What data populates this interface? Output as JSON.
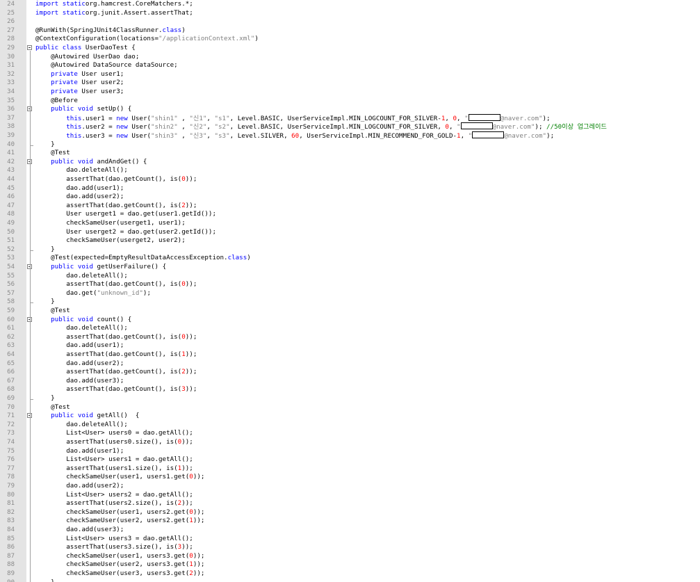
{
  "editor": {
    "lines": [
      {
        "n": "24",
        "fold": "",
        "tokens": [
          [
            "kw",
            "import static"
          ],
          [
            "",
            "org.hamcrest.CoreMatchers.*;"
          ]
        ]
      },
      {
        "n": "25",
        "fold": "",
        "tokens": [
          [
            "kw",
            "import static"
          ],
          [
            "",
            "org.junit.Assert.assertThat;"
          ]
        ]
      },
      {
        "n": "26",
        "fold": "",
        "tokens": []
      },
      {
        "n": "27",
        "fold": "",
        "tokens": [
          [
            "",
            "@RunWith(SpringJUnit4ClassRunner."
          ],
          [
            "kw",
            "class"
          ],
          [
            "",
            ")"
          ]
        ]
      },
      {
        "n": "28",
        "fold": "",
        "tokens": [
          [
            "",
            "@ContextConfiguration(locations="
          ],
          [
            "str",
            "\"/applicationContext.xml\""
          ],
          [
            "",
            ")"
          ]
        ]
      },
      {
        "n": "29",
        "fold": "open",
        "tokens": [
          [
            "kw",
            "public class"
          ],
          [
            "",
            " UserDaoTest {"
          ]
        ]
      },
      {
        "n": "30",
        "fold": "",
        "tokens": [
          [
            "",
            "    @Autowired UserDao dao;"
          ]
        ]
      },
      {
        "n": "31",
        "fold": "",
        "tokens": [
          [
            "",
            "    @Autowired DataSource dataSource;"
          ]
        ]
      },
      {
        "n": "32",
        "fold": "",
        "tokens": [
          [
            "",
            "    "
          ],
          [
            "kw",
            "private"
          ],
          [
            "",
            " User user1;"
          ]
        ]
      },
      {
        "n": "33",
        "fold": "",
        "tokens": [
          [
            "",
            "    "
          ],
          [
            "kw",
            "private"
          ],
          [
            "",
            " User user2;"
          ]
        ]
      },
      {
        "n": "34",
        "fold": "",
        "tokens": [
          [
            "",
            "    "
          ],
          [
            "kw",
            "private"
          ],
          [
            "",
            " User user3;"
          ]
        ]
      },
      {
        "n": "35",
        "fold": "",
        "tokens": [
          [
            "",
            "    @Before"
          ]
        ]
      },
      {
        "n": "36",
        "fold": "open",
        "tokens": [
          [
            "",
            "    "
          ],
          [
            "kw",
            "public void"
          ],
          [
            "",
            " setUp() {"
          ]
        ]
      },
      {
        "n": "37",
        "fold": "",
        "tokens": [
          [
            "",
            "        "
          ],
          [
            "kw",
            "this"
          ],
          [
            "",
            ".user1 = "
          ],
          [
            "kw",
            "new"
          ],
          [
            "",
            " User("
          ],
          [
            "str",
            "\"shin1\""
          ],
          [
            "",
            " , "
          ],
          [
            "str",
            "\"신1\""
          ],
          [
            "",
            ", "
          ],
          [
            "str",
            "\"s1\""
          ],
          [
            "",
            ", Level.BASIC, UserServiceImpl.MIN_LOGCOUNT_FOR_SILVER-"
          ],
          [
            "num",
            "1"
          ],
          [
            "",
            ", "
          ],
          [
            "num",
            "0"
          ],
          [
            "",
            ", "
          ],
          [
            "str",
            "\""
          ],
          [
            "redact",
            "46"
          ],
          [
            "str",
            "@naver.com\""
          ],
          [
            "",
            "); "
          ]
        ]
      },
      {
        "n": "38",
        "fold": "",
        "tokens": [
          [
            "",
            "        "
          ],
          [
            "kw",
            "this"
          ],
          [
            "",
            ".user2 = "
          ],
          [
            "kw",
            "new"
          ],
          [
            "",
            " User("
          ],
          [
            "str",
            "\"shin2\""
          ],
          [
            "",
            " , "
          ],
          [
            "str",
            "\"신2\""
          ],
          [
            "",
            ", "
          ],
          [
            "str",
            "\"s2\""
          ],
          [
            "",
            ", Level.BASIC, UserServiceImpl.MIN_LOGCOUNT_FOR_SILVER, "
          ],
          [
            "num",
            "0"
          ],
          [
            "",
            ", "
          ],
          [
            "str",
            "\""
          ],
          [
            "redact",
            "46"
          ],
          [
            "str",
            "@naver.com\""
          ],
          [
            "",
            "); "
          ],
          [
            "cmt",
            "//50이상 업그레이드"
          ]
        ]
      },
      {
        "n": "39",
        "fold": "",
        "tokens": [
          [
            "",
            "        "
          ],
          [
            "kw",
            "this"
          ],
          [
            "",
            ".user3 = "
          ],
          [
            "kw",
            "new"
          ],
          [
            "",
            " User("
          ],
          [
            "str",
            "\"shin3\""
          ],
          [
            "",
            " , "
          ],
          [
            "str",
            "\"신3\""
          ],
          [
            "",
            ", "
          ],
          [
            "str",
            "\"s3\""
          ],
          [
            "",
            ", Level.SILVER, "
          ],
          [
            "num",
            "60"
          ],
          [
            "",
            ", UserServiceImpl.MIN_RECOMMEND_FOR_GOLD-"
          ],
          [
            "num",
            "1"
          ],
          [
            "",
            ", "
          ],
          [
            "str",
            "\""
          ],
          [
            "redact",
            "46"
          ],
          [
            "str",
            "@naver.com\""
          ],
          [
            "",
            "); "
          ]
        ]
      },
      {
        "n": "40",
        "fold": "end",
        "tokens": [
          [
            "",
            "    }"
          ]
        ]
      },
      {
        "n": "41",
        "fold": "",
        "tokens": [
          [
            "",
            "    @Test"
          ]
        ]
      },
      {
        "n": "42",
        "fold": "open",
        "tokens": [
          [
            "",
            "    "
          ],
          [
            "kw",
            "public void"
          ],
          [
            "",
            " andAndGet() {"
          ]
        ]
      },
      {
        "n": "43",
        "fold": "",
        "tokens": [
          [
            "",
            "        dao.deleteAll();"
          ]
        ]
      },
      {
        "n": "44",
        "fold": "",
        "tokens": [
          [
            "",
            "        assertThat(dao.getCount(), is("
          ],
          [
            "num",
            "0"
          ],
          [
            "",
            "));"
          ]
        ]
      },
      {
        "n": "45",
        "fold": "",
        "tokens": [
          [
            "",
            "        dao.add(user1);"
          ]
        ]
      },
      {
        "n": "46",
        "fold": "",
        "tokens": [
          [
            "",
            "        dao.add(user2);"
          ]
        ]
      },
      {
        "n": "47",
        "fold": "",
        "tokens": [
          [
            "",
            "        assertThat(dao.getCount(), is("
          ],
          [
            "num",
            "2"
          ],
          [
            "",
            "));"
          ]
        ]
      },
      {
        "n": "48",
        "fold": "",
        "tokens": [
          [
            "",
            "        User userget1 = dao.get(user1.getId());"
          ]
        ]
      },
      {
        "n": "49",
        "fold": "",
        "tokens": [
          [
            "",
            "        checkSameUser(userget1, user1);"
          ]
        ]
      },
      {
        "n": "50",
        "fold": "",
        "tokens": [
          [
            "",
            "        User userget2 = dao.get(user2.getId());"
          ]
        ]
      },
      {
        "n": "51",
        "fold": "",
        "tokens": [
          [
            "",
            "        checkSameUser(userget2, user2);"
          ]
        ]
      },
      {
        "n": "52",
        "fold": "end",
        "tokens": [
          [
            "",
            "    }"
          ]
        ]
      },
      {
        "n": "53",
        "fold": "",
        "tokens": [
          [
            "",
            "    @Test(expected=EmptyResultDataAccessException."
          ],
          [
            "kw",
            "class"
          ],
          [
            "",
            ")"
          ]
        ]
      },
      {
        "n": "54",
        "fold": "open",
        "tokens": [
          [
            "",
            "    "
          ],
          [
            "kw",
            "public void"
          ],
          [
            "",
            " getUserFailure() {"
          ]
        ]
      },
      {
        "n": "55",
        "fold": "",
        "tokens": [
          [
            "",
            "        dao.deleteAll();"
          ]
        ]
      },
      {
        "n": "56",
        "fold": "",
        "tokens": [
          [
            "",
            "        assertThat(dao.getCount(), is("
          ],
          [
            "num",
            "0"
          ],
          [
            "",
            "));"
          ]
        ]
      },
      {
        "n": "57",
        "fold": "",
        "tokens": [
          [
            "",
            "        dao.get("
          ],
          [
            "str",
            "\"unknown_id\""
          ],
          [
            "",
            ");"
          ]
        ]
      },
      {
        "n": "58",
        "fold": "end",
        "tokens": [
          [
            "",
            "    }"
          ]
        ]
      },
      {
        "n": "59",
        "fold": "",
        "tokens": [
          [
            "",
            "    @Test"
          ]
        ]
      },
      {
        "n": "60",
        "fold": "open",
        "tokens": [
          [
            "",
            "    "
          ],
          [
            "kw",
            "public void"
          ],
          [
            "",
            " count() {"
          ]
        ]
      },
      {
        "n": "61",
        "fold": "",
        "tokens": [
          [
            "",
            "        dao.deleteAll();"
          ]
        ]
      },
      {
        "n": "62",
        "fold": "",
        "tokens": [
          [
            "",
            "        assertThat(dao.getCount(), is("
          ],
          [
            "num",
            "0"
          ],
          [
            "",
            "));"
          ]
        ]
      },
      {
        "n": "63",
        "fold": "",
        "tokens": [
          [
            "",
            "        dao.add(user1);"
          ]
        ]
      },
      {
        "n": "64",
        "fold": "",
        "tokens": [
          [
            "",
            "        assertThat(dao.getCount(), is("
          ],
          [
            "num",
            "1"
          ],
          [
            "",
            "));"
          ]
        ]
      },
      {
        "n": "65",
        "fold": "",
        "tokens": [
          [
            "",
            "        dao.add(user2);"
          ]
        ]
      },
      {
        "n": "66",
        "fold": "",
        "tokens": [
          [
            "",
            "        assertThat(dao.getCount(), is("
          ],
          [
            "num",
            "2"
          ],
          [
            "",
            "));"
          ]
        ]
      },
      {
        "n": "67",
        "fold": "",
        "tokens": [
          [
            "",
            "        dao.add(user3);"
          ]
        ]
      },
      {
        "n": "68",
        "fold": "",
        "tokens": [
          [
            "",
            "        assertThat(dao.getCount(), is("
          ],
          [
            "num",
            "3"
          ],
          [
            "",
            "));"
          ]
        ]
      },
      {
        "n": "69",
        "fold": "end",
        "tokens": [
          [
            "",
            "    }"
          ]
        ]
      },
      {
        "n": "70",
        "fold": "",
        "tokens": [
          [
            "",
            "    @Test"
          ]
        ]
      },
      {
        "n": "71",
        "fold": "open",
        "tokens": [
          [
            "",
            "    "
          ],
          [
            "kw",
            "public void"
          ],
          [
            "",
            " getAll()  {"
          ]
        ]
      },
      {
        "n": "72",
        "fold": "",
        "tokens": [
          [
            "",
            "        dao.deleteAll();"
          ]
        ]
      },
      {
        "n": "73",
        "fold": "",
        "tokens": [
          [
            "",
            "        List<User> users0 = dao.getAll();"
          ]
        ]
      },
      {
        "n": "74",
        "fold": "",
        "tokens": [
          [
            "",
            "        assertThat(users0.size(), is("
          ],
          [
            "num",
            "0"
          ],
          [
            "",
            "));"
          ]
        ]
      },
      {
        "n": "75",
        "fold": "",
        "tokens": [
          [
            "",
            "        dao.add(user1);"
          ]
        ]
      },
      {
        "n": "76",
        "fold": "",
        "tokens": [
          [
            "",
            "        List<User> users1 = dao.getAll();"
          ]
        ]
      },
      {
        "n": "77",
        "fold": "",
        "tokens": [
          [
            "",
            "        assertThat(users1.size(), is("
          ],
          [
            "num",
            "1"
          ],
          [
            "",
            "));"
          ]
        ]
      },
      {
        "n": "78",
        "fold": "",
        "tokens": [
          [
            "",
            "        checkSameUser(user1, users1.get("
          ],
          [
            "num",
            "0"
          ],
          [
            "",
            "));"
          ]
        ]
      },
      {
        "n": "79",
        "fold": "",
        "tokens": [
          [
            "",
            "        dao.add(user2);"
          ]
        ]
      },
      {
        "n": "80",
        "fold": "",
        "tokens": [
          [
            "",
            "        List<User> users2 = dao.getAll();"
          ]
        ]
      },
      {
        "n": "81",
        "fold": "",
        "tokens": [
          [
            "",
            "        assertThat(users2.size(), is("
          ],
          [
            "num",
            "2"
          ],
          [
            "",
            "));"
          ]
        ]
      },
      {
        "n": "82",
        "fold": "",
        "tokens": [
          [
            "",
            "        checkSameUser(user1, users2.get("
          ],
          [
            "num",
            "0"
          ],
          [
            "",
            "));"
          ]
        ]
      },
      {
        "n": "83",
        "fold": "",
        "tokens": [
          [
            "",
            "        checkSameUser(user2, users2.get("
          ],
          [
            "num",
            "1"
          ],
          [
            "",
            "));"
          ]
        ]
      },
      {
        "n": "84",
        "fold": "",
        "tokens": [
          [
            "",
            "        dao.add(user3);"
          ]
        ]
      },
      {
        "n": "85",
        "fold": "",
        "tokens": [
          [
            "",
            "        List<User> users3 = dao.getAll();"
          ]
        ]
      },
      {
        "n": "86",
        "fold": "",
        "tokens": [
          [
            "",
            "        assertThat(users3.size(), is("
          ],
          [
            "num",
            "3"
          ],
          [
            "",
            "));"
          ]
        ]
      },
      {
        "n": "87",
        "fold": "",
        "tokens": [
          [
            "",
            "        checkSameUser(user1, users3.get("
          ],
          [
            "num",
            "0"
          ],
          [
            "",
            "));"
          ]
        ]
      },
      {
        "n": "88",
        "fold": "",
        "tokens": [
          [
            "",
            "        checkSameUser(user2, users3.get("
          ],
          [
            "num",
            "1"
          ],
          [
            "",
            "));"
          ]
        ]
      },
      {
        "n": "89",
        "fold": "",
        "tokens": [
          [
            "",
            "        checkSameUser(user3, users3.get("
          ],
          [
            "num",
            "2"
          ],
          [
            "",
            "));"
          ]
        ]
      },
      {
        "n": "90",
        "fold": "end",
        "tokens": [
          [
            "",
            "    }"
          ]
        ]
      }
    ]
  },
  "colors": {
    "keyword": "#0000ff",
    "number": "#ff0000",
    "string": "#808080",
    "comment": "#008000",
    "gutter": "#e4e4e4",
    "line_number": "#8a8a8a"
  }
}
